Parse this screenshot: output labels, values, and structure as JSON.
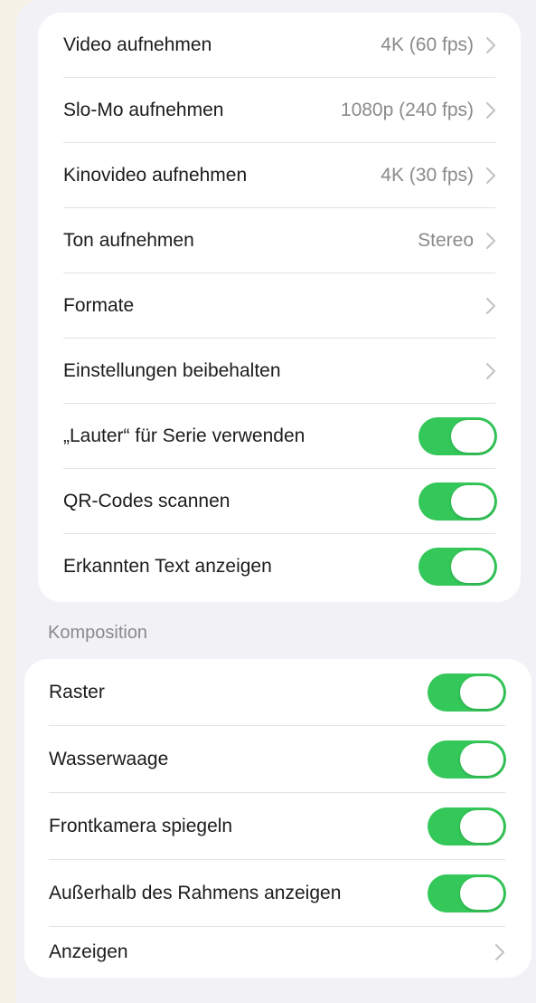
{
  "camera_settings": {
    "rows": [
      {
        "label": "Video aufnehmen",
        "value": "4K (60 fps)"
      },
      {
        "label": "Slo-Mo aufnehmen",
        "value": "1080p (240 fps)"
      },
      {
        "label": "Kinovideo aufnehmen",
        "value": "4K (30 fps)"
      },
      {
        "label": "Ton aufnehmen",
        "value": "Stereo"
      },
      {
        "label": "Formate"
      },
      {
        "label": "Einstellungen beibehalten"
      },
      {
        "label": "„Lauter“ für Serie verwenden",
        "toggle": true
      },
      {
        "label": "QR-Codes scannen",
        "toggle": true
      },
      {
        "label": "Erkannten Text anzeigen",
        "toggle": true
      }
    ]
  },
  "composition": {
    "header": "Komposition",
    "rows": [
      {
        "label": "Raster",
        "toggle": true
      },
      {
        "label": "Wasserwaage",
        "toggle": true
      },
      {
        "label": "Frontkamera spiegeln",
        "toggle": true
      },
      {
        "label": "Außerhalb des Rahmens anzeigen",
        "toggle": true
      },
      {
        "label": "Anzeigen"
      }
    ]
  },
  "colors": {
    "toggle_on": "#34c759",
    "background": "#f2f2f6",
    "chevron": "#c4c4c7"
  },
  "icons": {
    "chevron": "chevron-right-icon"
  }
}
